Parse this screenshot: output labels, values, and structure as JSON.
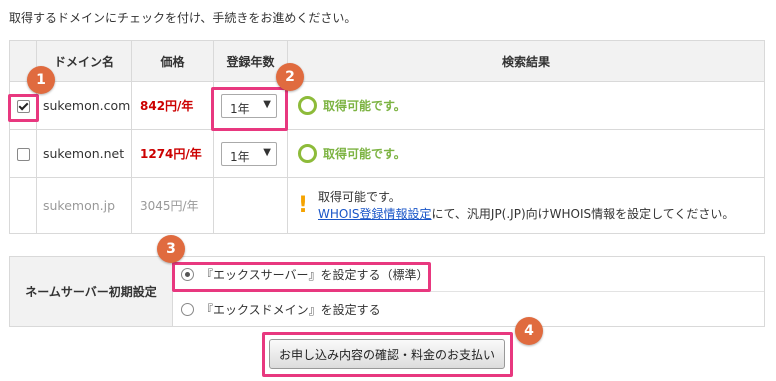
{
  "instruction": "取得するドメインにチェックを付け、手続きをお進めください。",
  "table": {
    "headers": [
      "ドメイン名",
      "価格",
      "登録年数",
      "検索結果"
    ],
    "rows": [
      {
        "checked": true,
        "domain": "sukemon.com",
        "price": "842円/年",
        "year": "1年",
        "result": "取得可能です。"
      },
      {
        "checked": false,
        "domain": "sukemon.net",
        "price": "1274円/年",
        "year": "1年",
        "result": "取得可能です。"
      },
      {
        "disabled": true,
        "domain": "sukemon.jp",
        "price": "3045円/年",
        "result_line1": "取得可能です。",
        "result_link": "WHOIS登録情報設定",
        "result_line2_suffix": "にて、汎用JP(.JP)向けWHOIS情報を設定してください。"
      }
    ]
  },
  "nameserver": {
    "label": "ネームサーバー初期設定",
    "options": [
      {
        "label": "『エックスサーバー』を設定する（標準）",
        "selected": true
      },
      {
        "label": "『エックスドメイン』を設定する",
        "selected": false
      }
    ]
  },
  "submit_label": "お申し込み内容の確認・料金のお支払い",
  "badges": [
    "1",
    "2",
    "3",
    "4"
  ],
  "colors": {
    "highlight": "#e8387f",
    "badge": "#e06b3f",
    "price": "#cc0000",
    "ok": "#8dbb3a",
    "link": "#1a56c8",
    "warning": "#f5a300"
  }
}
